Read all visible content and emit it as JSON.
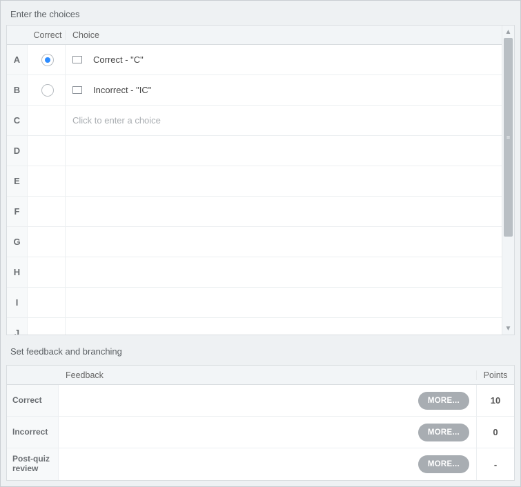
{
  "sections": {
    "choices_title": "Enter the choices",
    "feedback_title": "Set feedback and branching"
  },
  "choices_table": {
    "header_correct": "Correct",
    "header_choice": "Choice",
    "placeholder": "Click to enter a choice",
    "rows": [
      {
        "letter": "A",
        "has_correct_radio": true,
        "checked": true,
        "has_thumb": true,
        "text": "Correct - \"C\""
      },
      {
        "letter": "B",
        "has_correct_radio": true,
        "checked": false,
        "has_thumb": true,
        "text": "Incorrect - \"IC\""
      },
      {
        "letter": "C",
        "has_correct_radio": false,
        "checked": false,
        "has_thumb": false,
        "text": ""
      },
      {
        "letter": "D",
        "has_correct_radio": false,
        "checked": false,
        "has_thumb": false,
        "text": ""
      },
      {
        "letter": "E",
        "has_correct_radio": false,
        "checked": false,
        "has_thumb": false,
        "text": ""
      },
      {
        "letter": "F",
        "has_correct_radio": false,
        "checked": false,
        "has_thumb": false,
        "text": ""
      },
      {
        "letter": "G",
        "has_correct_radio": false,
        "checked": false,
        "has_thumb": false,
        "text": ""
      },
      {
        "letter": "H",
        "has_correct_radio": false,
        "checked": false,
        "has_thumb": false,
        "text": ""
      },
      {
        "letter": "I",
        "has_correct_radio": false,
        "checked": false,
        "has_thumb": false,
        "text": ""
      },
      {
        "letter": "J",
        "has_correct_radio": false,
        "checked": false,
        "has_thumb": false,
        "text": ""
      }
    ]
  },
  "feedback_table": {
    "header_feedback": "Feedback",
    "header_points": "Points",
    "more_label": "MORE...",
    "rows": [
      {
        "label": "Correct",
        "points": "10"
      },
      {
        "label": "Incorrect",
        "points": "0"
      },
      {
        "label": "Post-quiz review",
        "points": "-"
      }
    ]
  }
}
